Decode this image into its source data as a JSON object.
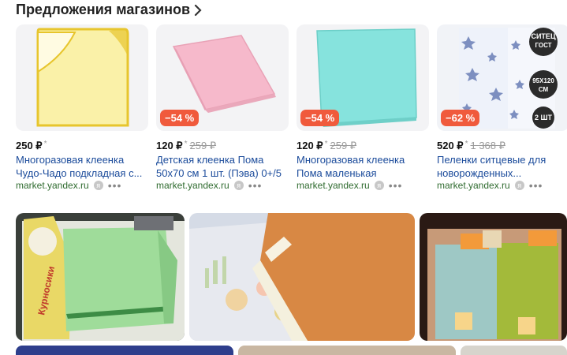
{
  "section": {
    "title": "Предложения магазинов"
  },
  "offers": [
    {
      "badge": "",
      "price": "250 ₽",
      "star": "*",
      "old_price": "",
      "title": "Многоразовая клеенка Чудо-Чадо подкладная с...",
      "shop": "market.yandex.ru",
      "product_color": "#f7ec96"
    },
    {
      "badge": "−54 %",
      "price": "120 ₽",
      "star": "*",
      "old_price": "259 ₽",
      "title": "Детская клеенка Пома 50x70 см 1 шт. (Пэва) 0+/5",
      "shop": "market.yandex.ru",
      "product_color": "#f5b7c8"
    },
    {
      "badge": "−54 %",
      "price": "120 ₽",
      "star": "*",
      "old_price": "259 ₽",
      "title": "Многоразовая клеенка Пома маленькая",
      "shop": "market.yandex.ru",
      "product_color": "#85e2dc"
    },
    {
      "badge": "−62 %",
      "price": "520 ₽",
      "star": "*",
      "old_price": "1 368 ₽",
      "title": "Пеленки ситцевые для новорожденных...",
      "shop": "market.yandex.ru",
      "product_color": "#e9eef8"
    }
  ],
  "photo_labels": {
    "sticker_line1": "СИТЕЦ",
    "sticker_line2": "ГОСТ",
    "sticker_size_1": "95Х120",
    "sticker_size_2": "СМ",
    "sticker_count": "2 ШТ",
    "pack_brand": "Курносики"
  },
  "colors": {
    "link": "#1b4b9b",
    "shop": "#2f6b2f",
    "badge": "#f05a3c"
  }
}
